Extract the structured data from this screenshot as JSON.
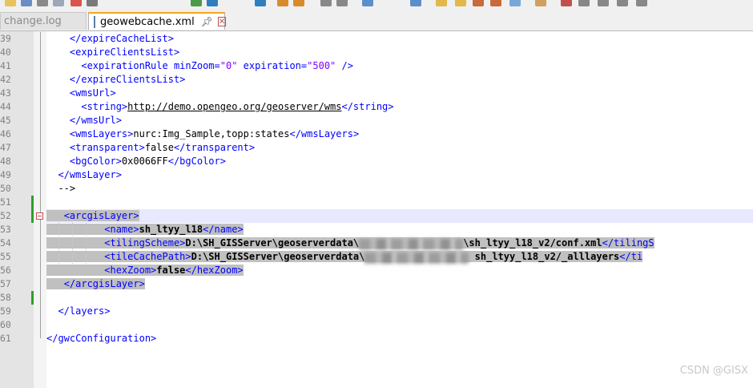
{
  "tabs": [
    {
      "label": "change.log",
      "active": false
    },
    {
      "label": "geowebcache.xml",
      "active": true
    }
  ],
  "icons": {
    "pin": "pin-icon",
    "close": "close-icon",
    "file": "file-icon"
  },
  "lines": [
    {
      "num": "39",
      "parts": [
        [
          "t",
          "    </expireCacheList>"
        ]
      ]
    },
    {
      "num": "40",
      "parts": [
        [
          "t",
          "    <expireClientsList>"
        ]
      ]
    },
    {
      "num": "41",
      "parts": [
        [
          "t",
          "      <expirationRule minZoom=\"0\" expiration=\"500\" />"
        ]
      ]
    },
    {
      "num": "42",
      "parts": [
        [
          "t",
          "    </expireClientsList>"
        ]
      ]
    },
    {
      "num": "43",
      "parts": [
        [
          "t",
          "    <wmsUrl>"
        ]
      ]
    },
    {
      "num": "44",
      "parts": [
        [
          "t",
          "      <string>"
        ],
        [
          "u",
          "http://demo.opengeo.org/geoserver/wms"
        ],
        [
          "t",
          "</string>"
        ]
      ]
    },
    {
      "num": "45",
      "parts": [
        [
          "t",
          "    </wmsUrl>"
        ]
      ]
    },
    {
      "num": "46",
      "parts": [
        [
          "t",
          "    <wmsLayers>nurc:Img_Sample,topp:states</wmsLayers>"
        ]
      ]
    },
    {
      "num": "47",
      "parts": [
        [
          "t",
          "    <transparent>false</transparent>"
        ]
      ]
    },
    {
      "num": "48",
      "parts": [
        [
          "t",
          "    <bgColor>0x0066FF</bgColor>"
        ]
      ]
    },
    {
      "num": "49",
      "parts": [
        [
          "t",
          "  </wmsLayer>"
        ]
      ]
    },
    {
      "num": "50",
      "parts": [
        [
          "t",
          "  -->"
        ]
      ]
    },
    {
      "num": "51",
      "parts": []
    },
    {
      "num": "52",
      "parts": [
        [
          "s",
          "   "
        ],
        [
          "tag",
          "<arcgisLayer>"
        ]
      ]
    },
    {
      "num": "53",
      "parts": [
        [
          "s",
          "          "
        ],
        [
          "tag",
          "<name>"
        ],
        [
          "bold",
          "sh_ltyy_l18"
        ],
        [
          "tag",
          "</name>"
        ]
      ]
    },
    {
      "num": "54",
      "parts": [
        [
          "s",
          "          "
        ],
        [
          "tag",
          "<tilingScheme>"
        ],
        [
          "bold",
          "D:\\SH_GISServer\\geoserverdata\\"
        ],
        [
          "blur",
          "                  "
        ],
        [
          "bold",
          "\\sh_ltyy_l18_v2/conf.xml"
        ],
        [
          "tag",
          "</tilingS"
        ]
      ]
    },
    {
      "num": "55",
      "parts": [
        [
          "s",
          "          "
        ],
        [
          "tag",
          "<tileCachePath>"
        ],
        [
          "bold",
          "D:\\SH_GISServer\\geoserverdata\\"
        ],
        [
          "blur",
          "                  "
        ],
        [
          "bold",
          " sh_ltyy_l18_v2/_alllayers"
        ],
        [
          "tag",
          "</ti"
        ]
      ]
    },
    {
      "num": "56",
      "parts": [
        [
          "s",
          "          "
        ],
        [
          "tag",
          "<hexZoom>"
        ],
        [
          "bold",
          "false"
        ],
        [
          "tag",
          "</hexZoom>"
        ]
      ]
    },
    {
      "num": "57",
      "parts": [
        [
          "s",
          "   "
        ],
        [
          "tag",
          "</arcgisLayer>"
        ]
      ]
    },
    {
      "num": "58",
      "parts": []
    },
    {
      "num": "59",
      "parts": [
        [
          "t",
          "  </layers>"
        ]
      ]
    },
    {
      "num": "60",
      "parts": []
    },
    {
      "num": "61",
      "parts": [
        [
          "t",
          "</gwcConfiguration>"
        ]
      ]
    }
  ],
  "watermark": "CSDN @GISX",
  "colors": {
    "tag": "#0000ff",
    "selection": "#c0c0c0",
    "current_line": "#e8e8ff",
    "tab_accent": "#f2a81d",
    "change_bar": "#2e9e2e"
  }
}
